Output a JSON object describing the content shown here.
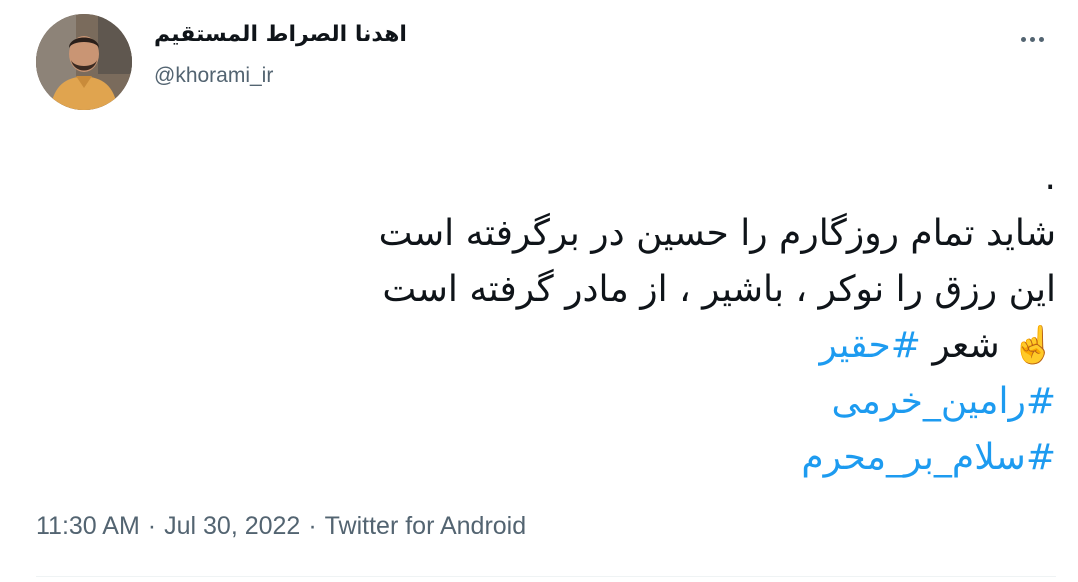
{
  "user": {
    "display_name": "اهدنا الصراط المستقیم",
    "handle": "@khorami_ir",
    "avatar_icon": "profile-photo"
  },
  "more_icon": "more-horizontal-icon",
  "tweet": {
    "lines": [
      ".",
      "شاید تمام روزگارم را حسین در برگرفته است",
      "این رزق را نوکر ، باشیر ، از مادر گرفته است"
    ],
    "emoji": "☝️",
    "word": "شعر",
    "hashtags": [
      "#حقیر",
      "#رامین_خرمی",
      "#سلام_بر_محرم"
    ]
  },
  "meta": {
    "time": "11:30 AM",
    "separator": "·",
    "date": "Jul 30, 2022",
    "source": "Twitter for Android"
  },
  "colors": {
    "link": "#1d9bf0",
    "secondary_text": "#536471",
    "primary_text": "#0f1419"
  }
}
